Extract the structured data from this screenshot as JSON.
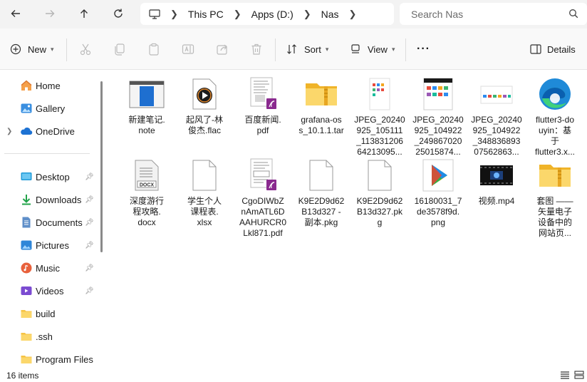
{
  "address": {
    "segments": [
      "This PC",
      "Apps (D:)",
      "Nas"
    ],
    "search_placeholder": "Search Nas"
  },
  "toolbar": {
    "new_label": "New",
    "sort_label": "Sort",
    "view_label": "View",
    "more_label": "···",
    "details_label": "Details"
  },
  "sidebar": {
    "items": [
      {
        "label": "Home",
        "icon": "home-icon"
      },
      {
        "label": "Gallery",
        "icon": "gallery-icon"
      },
      {
        "label": "OneDrive",
        "icon": "onedrive-icon"
      },
      {
        "label": "Desktop",
        "icon": "desktop-icon"
      },
      {
        "label": "Downloads",
        "icon": "downloads-icon"
      },
      {
        "label": "Documents",
        "icon": "documents-icon"
      },
      {
        "label": "Pictures",
        "icon": "pictures-icon"
      },
      {
        "label": "Music",
        "icon": "music-icon"
      },
      {
        "label": "Videos",
        "icon": "videos-icon"
      },
      {
        "label": "build",
        "icon": "folder-icon"
      },
      {
        "label": ".ssh",
        "icon": "folder-icon"
      },
      {
        "label": "Program Files",
        "icon": "folder-icon"
      }
    ]
  },
  "files": [
    {
      "name": "新建笔记.\nnote",
      "icon": "note-file-icon"
    },
    {
      "name": "起风了-林\n俊杰.flac",
      "icon": "audio-file-icon"
    },
    {
      "name": "百度新闻.\npdf",
      "icon": "pdf-file-icon"
    },
    {
      "name": "grafana-os\ns_10.1.1.tar",
      "icon": "zip-folder-icon"
    },
    {
      "name": "JPEG_20240\n925_105111\n_113831206\n64213095...",
      "icon": "image-file-icon"
    },
    {
      "name": "JPEG_20240\n925_104922\n_249867020\n25015874...",
      "icon": "image-file-icon"
    },
    {
      "name": "JPEG_20240\n925_104922\n_348836893\n07562863...",
      "icon": "image-file-icon"
    },
    {
      "name": "flutter3-do\nuyin：基\n于\nflutter3.x...",
      "icon": "edge-icon"
    },
    {
      "name": "深度游行\n程攻略.\ndocx",
      "icon": "docx-file-icon"
    },
    {
      "name": "学生个人\n课程表.\nxlsx",
      "icon": "blank-file-icon"
    },
    {
      "name": "CgoDIWbZ\nnAmATL6D\nAAHURCR0\nLkl871.pdf",
      "icon": "pdf-file-icon"
    },
    {
      "name": "K9E2D9d62\nB13d327 -\n副本.pkg",
      "icon": "blank-file-icon"
    },
    {
      "name": "K9E2D9d62\nB13d327.pk\ng",
      "icon": "blank-file-icon"
    },
    {
      "name": "16180031_7\nde3578f9d.\npng",
      "icon": "png-file-icon"
    },
    {
      "name": "视频.mp4",
      "icon": "video-file-icon"
    },
    {
      "name": "套图 ——\n矢量电子\n设备中的\n网站页...",
      "icon": "zip-folder-icon"
    }
  ],
  "status": {
    "count": "16 items"
  },
  "colors": {
    "accent": "#0067c0",
    "folder": "#f6c344",
    "pdf": "#8a2a8f"
  }
}
